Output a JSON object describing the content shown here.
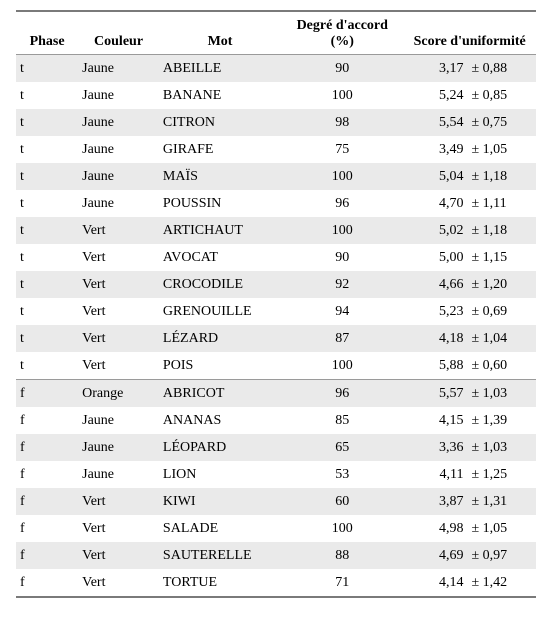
{
  "headers": {
    "phase": "Phase",
    "color": "Couleur",
    "mot": "Mot",
    "degree": "Degré d'accord (%)",
    "score": "Score d'uniformité"
  },
  "rows": [
    {
      "phase": "t",
      "color": "Jaune",
      "mot": "ABEILLE",
      "degree": "90",
      "score": "3,17",
      "pm": "± 0,88"
    },
    {
      "phase": "t",
      "color": "Jaune",
      "mot": "BANANE",
      "degree": "100",
      "score": "5,24",
      "pm": "± 0,85"
    },
    {
      "phase": "t",
      "color": "Jaune",
      "mot": "CITRON",
      "degree": "98",
      "score": "5,54",
      "pm": "± 0,75"
    },
    {
      "phase": "t",
      "color": "Jaune",
      "mot": "GIRAFE",
      "degree": "75",
      "score": "3,49",
      "pm": "± 1,05"
    },
    {
      "phase": "t",
      "color": "Jaune",
      "mot": "MAÏS",
      "degree": "100",
      "score": "5,04",
      "pm": "± 1,18"
    },
    {
      "phase": "t",
      "color": "Jaune",
      "mot": "POUSSIN",
      "degree": "96",
      "score": "4,70",
      "pm": "± 1,11"
    },
    {
      "phase": "t",
      "color": "Vert",
      "mot": "ARTICHAUT",
      "degree": "100",
      "score": "5,02",
      "pm": "± 1,18"
    },
    {
      "phase": "t",
      "color": "Vert",
      "mot": "AVOCAT",
      "degree": "90",
      "score": "5,00",
      "pm": "± 1,15"
    },
    {
      "phase": "t",
      "color": "Vert",
      "mot": "CROCODILE",
      "degree": "92",
      "score": "4,66",
      "pm": "± 1,20"
    },
    {
      "phase": "t",
      "color": "Vert",
      "mot": "GRENOUILLE",
      "degree": "94",
      "score": "5,23",
      "pm": "± 0,69"
    },
    {
      "phase": "t",
      "color": "Vert",
      "mot": "LÉZARD",
      "degree": "87",
      "score": "4,18",
      "pm": "± 1,04"
    },
    {
      "phase": "t",
      "color": "Vert",
      "mot": "POIS",
      "degree": "100",
      "score": "5,88",
      "pm": "± 0,60"
    },
    {
      "phase": "f",
      "color": "Orange",
      "mot": "ABRICOT",
      "degree": "96",
      "score": "5,57",
      "pm": "± 1,03"
    },
    {
      "phase": "f",
      "color": "Jaune",
      "mot": "ANANAS",
      "degree": "85",
      "score": "4,15",
      "pm": "± 1,39"
    },
    {
      "phase": "f",
      "color": "Jaune",
      "mot": "LÉOPARD",
      "degree": "65",
      "score": "3,36",
      "pm": "± 1,03"
    },
    {
      "phase": "f",
      "color": "Jaune",
      "mot": "LION",
      "degree": "53",
      "score": "4,11",
      "pm": "± 1,25"
    },
    {
      "phase": "f",
      "color": "Vert",
      "mot": "KIWI",
      "degree": "60",
      "score": "3,87",
      "pm": "± 1,31"
    },
    {
      "phase": "f",
      "color": "Vert",
      "mot": "SALADE",
      "degree": "100",
      "score": "4,98",
      "pm": "± 1,05"
    },
    {
      "phase": "f",
      "color": "Vert",
      "mot": "SAUTERELLE",
      "degree": "88",
      "score": "4,69",
      "pm": "± 0,97"
    },
    {
      "phase": "f",
      "color": "Vert",
      "mot": "TORTUE",
      "degree": "71",
      "score": "4,14",
      "pm": "± 1,42"
    }
  ],
  "section_split_index": 12
}
